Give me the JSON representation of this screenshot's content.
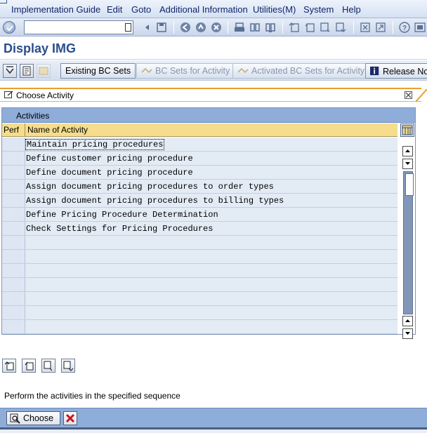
{
  "menu": {
    "items": [
      "Implementation Guide",
      "Edit",
      "Goto",
      "Additional Information",
      "Utilities(M)",
      "System",
      "Help"
    ]
  },
  "toolbar": {
    "command_field_value": "",
    "icons": [
      "enter-icon",
      "back-icon",
      "save-icon",
      "back-nav-icon",
      "exit-icon",
      "cancel-icon",
      "print-icon",
      "find-icon",
      "find-next-icon",
      "first-page-icon",
      "previous-page-icon",
      "next-page-icon",
      "last-page-icon",
      "create-session-icon",
      "shortcut-icon",
      "help-icon",
      "layout-icon"
    ]
  },
  "page": {
    "title": "Display IMG"
  },
  "app_toolbar": {
    "existing_bc_sets": "Existing BC Sets",
    "bc_sets_for_activity": "BC Sets for Activity",
    "activated_bc_sets": "Activated BC Sets for Activity",
    "release_notes": "Release No"
  },
  "dialog": {
    "title": "Choose Activity",
    "table": {
      "title": "Activities",
      "columns": [
        "Perf",
        "Name of Activity"
      ],
      "rows": [
        "Maintain pricing procedures",
        "Define customer pricing procedure",
        "Define document pricing procedure",
        "Assign document pricing procedures to order types",
        "Assign document pricing procedures to billing types",
        "Define Pricing Procedure Determination",
        "Check Settings for Pricing Procedures",
        "",
        "",
        "",
        "",
        "",
        "",
        ""
      ]
    },
    "hint": "Perform the activities in the specified sequence",
    "choose_label": "Choose"
  },
  "colors": {
    "title_blue": "#2a4e8c",
    "header_gold": "#f5dd8d",
    "table_title_blue": "#8fadd9",
    "row_blue": "#e3ebf5",
    "accent_orange": "#e8a02c"
  }
}
